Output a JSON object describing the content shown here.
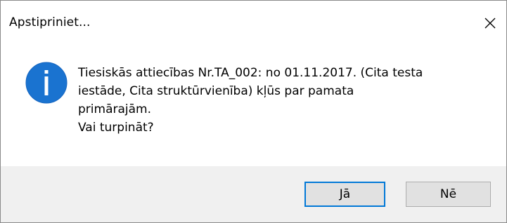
{
  "window": {
    "title": "Apstipriniet...",
    "close_icon": "close-icon"
  },
  "message": {
    "icon": "info-icon",
    "icon_color": "#1a73d0",
    "lines": [
      "Tiesiskās attiecības Nr.TA_002: no 01.11.2017. (Cita testa",
      "iestāde, Cita struktūrvienība) kļūs par pamata",
      "primārajām.",
      "Vai turpināt?"
    ]
  },
  "buttons": {
    "yes_label": "Jā",
    "no_label": "Nē"
  },
  "colors": {
    "accent": "#0078d7",
    "footer_bg": "#f0f0f0",
    "button_bg": "#e1e1e1"
  }
}
